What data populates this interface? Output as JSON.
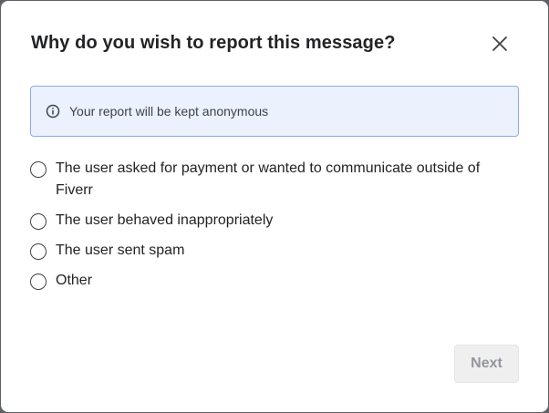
{
  "dialog": {
    "title": "Why do you wish to report this message?",
    "close_icon": "close-icon",
    "info": {
      "icon": "info-icon",
      "text": "Your report will be kept anonymous"
    },
    "options": [
      {
        "label": "The user asked for payment or wanted to communicate outside of Fiverr",
        "selected": false
      },
      {
        "label": "The user behaved inappropriately",
        "selected": false
      },
      {
        "label": "The user sent spam",
        "selected": false
      },
      {
        "label": "Other",
        "selected": false
      }
    ],
    "next_label": "Next",
    "next_enabled": false
  },
  "colors": {
    "info_bg": "#ebf1fd",
    "info_border": "#8aaaf0",
    "title_text": "#222325",
    "button_disabled_bg": "#efeff0",
    "button_disabled_text": "#95979d"
  }
}
